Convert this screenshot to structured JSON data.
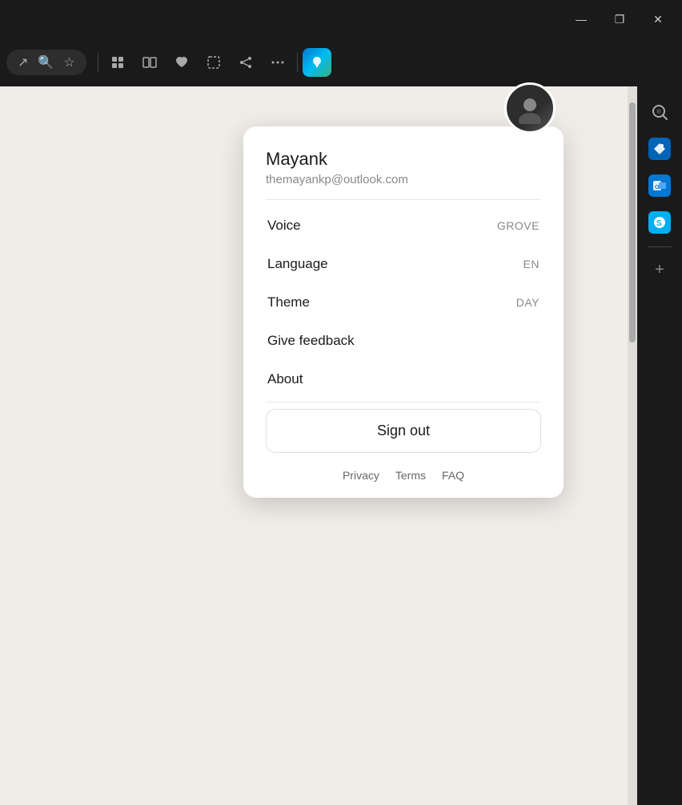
{
  "titleBar": {
    "minimizeLabel": "—",
    "restoreLabel": "❐",
    "closeLabel": "✕"
  },
  "toolbar": {
    "icons": [
      "↗",
      "🔍",
      "☆"
    ]
  },
  "user": {
    "name": "Mayank",
    "email": "themayankp@outlook.com",
    "avatarInitial": "👤"
  },
  "menuItems": [
    {
      "label": "Voice",
      "value": "GROVE"
    },
    {
      "label": "Language",
      "value": "EN"
    },
    {
      "label": "Theme",
      "value": "DAY"
    },
    {
      "label": "Give feedback",
      "value": ""
    },
    {
      "label": "About",
      "value": ""
    }
  ],
  "signOutLabel": "Sign out",
  "footerLinks": [
    {
      "label": "Privacy"
    },
    {
      "label": "Terms"
    },
    {
      "label": "FAQ"
    }
  ],
  "sidebar": {
    "searchIcon": "🔍",
    "addLabel": "+"
  }
}
